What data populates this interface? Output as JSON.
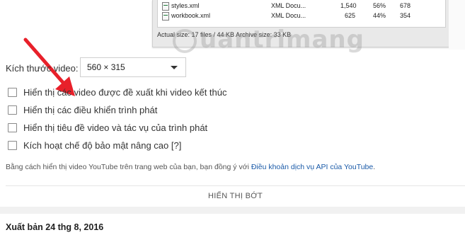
{
  "archive_window": {
    "rows": [
      {
        "name": "styles.xml",
        "type": "XML Docu...",
        "size": "1,540",
        "ratio": "56%",
        "packed": "678"
      },
      {
        "name": "workbook.xml",
        "type": "XML Docu...",
        "size": "625",
        "ratio": "44%",
        "packed": "354"
      }
    ],
    "status": "Actual size: 17 files / 44 KB  Archive size: 33 KB"
  },
  "watermark": "uantrimang",
  "embed": {
    "size_label": "Kích thước video:",
    "size_value": "560 × 315",
    "options": [
      {
        "label": "Hiển thị các video được đề xuất khi video kết thúc",
        "checked": false
      },
      {
        "label": "Hiển thị các điều khiển trình phát",
        "checked": false
      },
      {
        "label": "Hiển thị tiêu đề video và tác vụ của trình phát",
        "checked": false
      },
      {
        "label": "Kích hoạt chế độ bảo mật nâng cao [?]",
        "checked": false
      }
    ],
    "terms_prefix": "Bằng cách hiển thị video YouTube trên trang web của bạn, bạn đồng ý với ",
    "terms_link": "Điều khoản dịch vụ API của YouTube",
    "terms_suffix": ".",
    "show_less": "HIỂN THỊ BỚT"
  },
  "published": "Xuất bản 24 thg 8, 2016",
  "colors": {
    "arrow": "#e8202a",
    "link": "#1a5aa8"
  }
}
